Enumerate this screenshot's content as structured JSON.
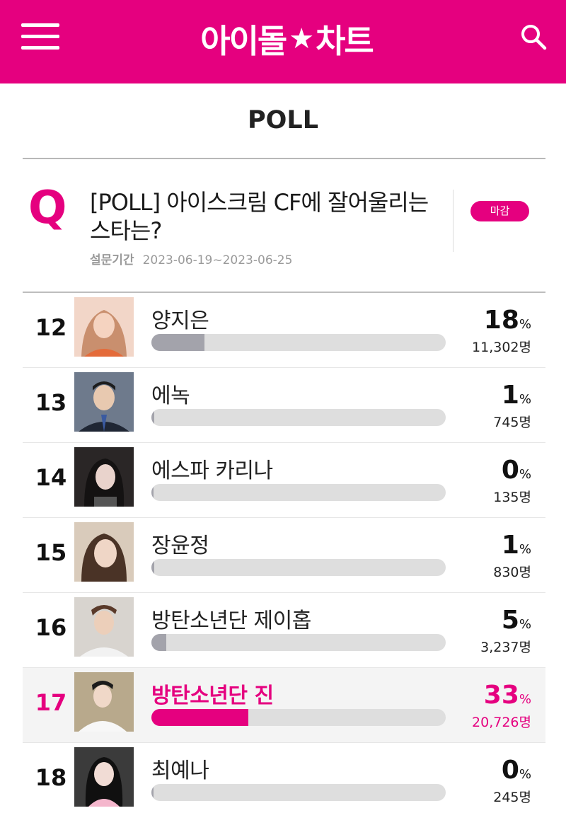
{
  "header": {
    "logo_left": "아이돌",
    "logo_right": "차트",
    "accent_color": "#e5007f"
  },
  "page_title": "POLL",
  "question": {
    "mark": "Q",
    "text": "[POLL] 아이스크림 CF에 잘어울리는 스타는?",
    "period_label": "설문기간",
    "period_value": "2023-06-19~2023-06-25",
    "status": "마감"
  },
  "items": [
    {
      "rank": "12",
      "name": "양지은",
      "percent": 18,
      "percent_text": "18",
      "percent_unit": "%",
      "votes": "11,302명",
      "highlight": false
    },
    {
      "rank": "13",
      "name": "에녹",
      "percent": 1,
      "percent_text": "1",
      "percent_unit": "%",
      "votes": "745명",
      "highlight": false
    },
    {
      "rank": "14",
      "name": "에스파 카리나",
      "percent": 0,
      "percent_text": "0",
      "percent_unit": "%",
      "votes": "135명",
      "highlight": false
    },
    {
      "rank": "15",
      "name": "장윤정",
      "percent": 1,
      "percent_text": "1",
      "percent_unit": "%",
      "votes": "830명",
      "highlight": false
    },
    {
      "rank": "16",
      "name": "방탄소년단 제이홉",
      "percent": 5,
      "percent_text": "5",
      "percent_unit": "%",
      "votes": "3,237명",
      "highlight": false
    },
    {
      "rank": "17",
      "name": "방탄소년단 진",
      "percent": 33,
      "percent_text": "33",
      "percent_unit": "%",
      "votes": "20,726명",
      "highlight": true
    },
    {
      "rank": "18",
      "name": "최예나",
      "percent": 0,
      "percent_text": "0",
      "percent_unit": "%",
      "votes": "245명",
      "highlight": false
    }
  ]
}
